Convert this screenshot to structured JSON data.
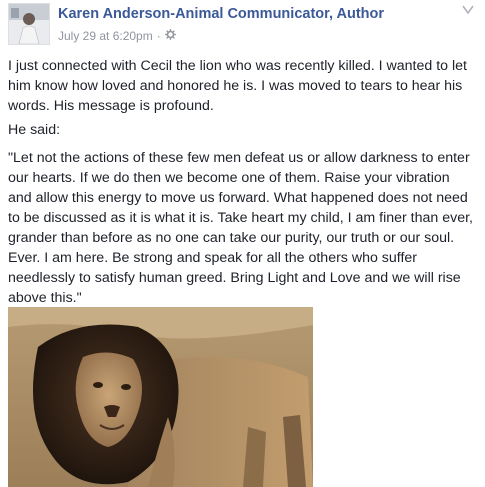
{
  "post": {
    "author": "Karen Anderson-Animal Communicator, Author",
    "timestamp": "July 29 at 6:20pm",
    "separator": "·",
    "audience_icon": "gear-icon",
    "menu_icon": "chevron-down-icon",
    "paragraphs": [
      "I just connected with Cecil the lion who was recently killed. I wanted to let him know how loved and honored he is. I was moved to tears to hear his words. His message is profound.",
      "He said:",
      "\"Let not the actions of these few men defeat us or allow darkness to enter our hearts. If we do then we become one of them. Raise your vibration and allow this energy to move us forward. What happened does not need to be discussed as it is what it is. Take heart my child, I am finer than ever, grander than before as no one can take our purity, our truth or our soul. Ever. I am here. Be strong and speak for all the others who suffer needlessly to satisfy human greed. Bring Light and Love and we will rise above this.\""
    ]
  },
  "colors": {
    "author_link": "#3b5998",
    "body_text": "#1d2129",
    "meta_text": "#90949c",
    "background": "#ffffff"
  }
}
